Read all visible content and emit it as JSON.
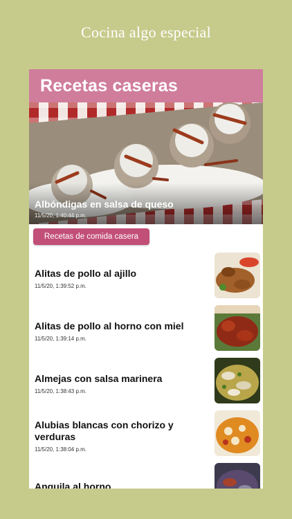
{
  "tagline": "Cocina algo especial",
  "navbar": {
    "title": "Recetas caseras"
  },
  "featured": {
    "title": "Albóndigas en salsa de queso",
    "date": "11/5/20, 1:40:44 p.m."
  },
  "category_button": "Recetas de comida casera",
  "recipes": [
    {
      "title": "Alitas de pollo al ajillo",
      "date": "11/5/20, 1:39:52 p.m."
    },
    {
      "title": "Alitas de pollo al horno con miel",
      "date": "11/5/20, 1:39:14 p.m."
    },
    {
      "title": "Almejas con salsa marinera",
      "date": "11/5/20, 1:38:43 p.m."
    },
    {
      "title": "Alubias blancas con chorizo y verduras",
      "date": "11/5/20, 1:38:04 p.m."
    },
    {
      "title": "Anguila al horno",
      "date": ""
    }
  ]
}
